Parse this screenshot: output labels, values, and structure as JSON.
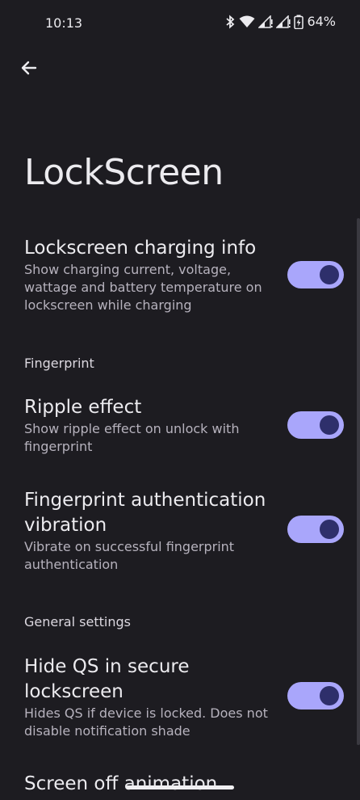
{
  "status_bar": {
    "time": "10:13",
    "battery_percent": "64%",
    "icons": [
      "bluetooth-icon",
      "wifi-icon",
      "signal-icon",
      "signal-icon",
      "battery-charging-icon"
    ]
  },
  "header": {
    "back_icon": "arrow-left-icon",
    "title": "LockScreen"
  },
  "settings": {
    "charging_info": {
      "title": "Lockscreen charging info",
      "summary": "Show charging current, voltage, wattage and battery temperature on lockscreen while charging",
      "enabled": true
    },
    "section_fingerprint": "Fingerprint",
    "ripple": {
      "title": "Ripple effect",
      "summary": "Show ripple effect on unlock with fingerprint",
      "enabled": true
    },
    "fp_vibration": {
      "title": "Fingerprint authentication vibration",
      "summary": "Vibrate on successful fingerprint authentication",
      "enabled": true
    },
    "section_general": "General settings",
    "hide_qs": {
      "title": "Hide QS in secure lockscreen",
      "summary": "Hides QS if device is locked. Does not disable notification shade",
      "enabled": true
    },
    "screen_off": {
      "title": "Screen off animation"
    }
  },
  "colors": {
    "background": "#1d1c21",
    "toggle_track": "#a9a6fb",
    "toggle_knob": "#2e2f6b"
  }
}
